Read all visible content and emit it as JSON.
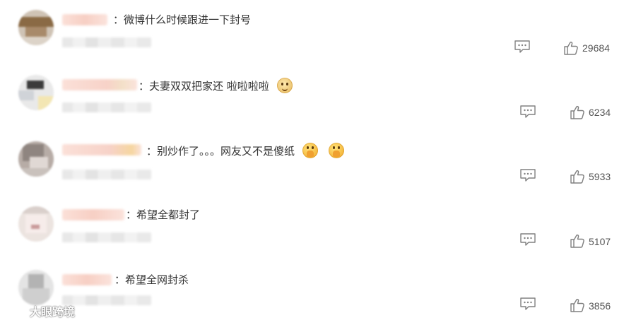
{
  "comments": [
    {
      "text": "：微博什么时候跟进一下封号",
      "emojis": [],
      "likes": "29684"
    },
    {
      "text": "：夫妻双双把家还 啦啦啦啦",
      "emojis": [
        "doge-emoji"
      ],
      "likes": "6234"
    },
    {
      "text": "：别炒作了。。。网友又不是傻纸",
      "emojis": [
        "pray-emoji",
        "pray-emoji"
      ],
      "likes": "5933"
    },
    {
      "text": "：希望全都封了",
      "emojis": [],
      "likes": "5107"
    },
    {
      "text": "：希望全网封杀",
      "emojis": [],
      "likes": "3856"
    }
  ],
  "icons": {
    "reply": "comment-bubble-icon",
    "like": "thumbs-up-icon"
  },
  "watermark": {
    "text": "大眼跨境"
  },
  "colors": {
    "text": "#333333",
    "icon": "#808080",
    "count": "#555555",
    "background": "#ffffff"
  }
}
